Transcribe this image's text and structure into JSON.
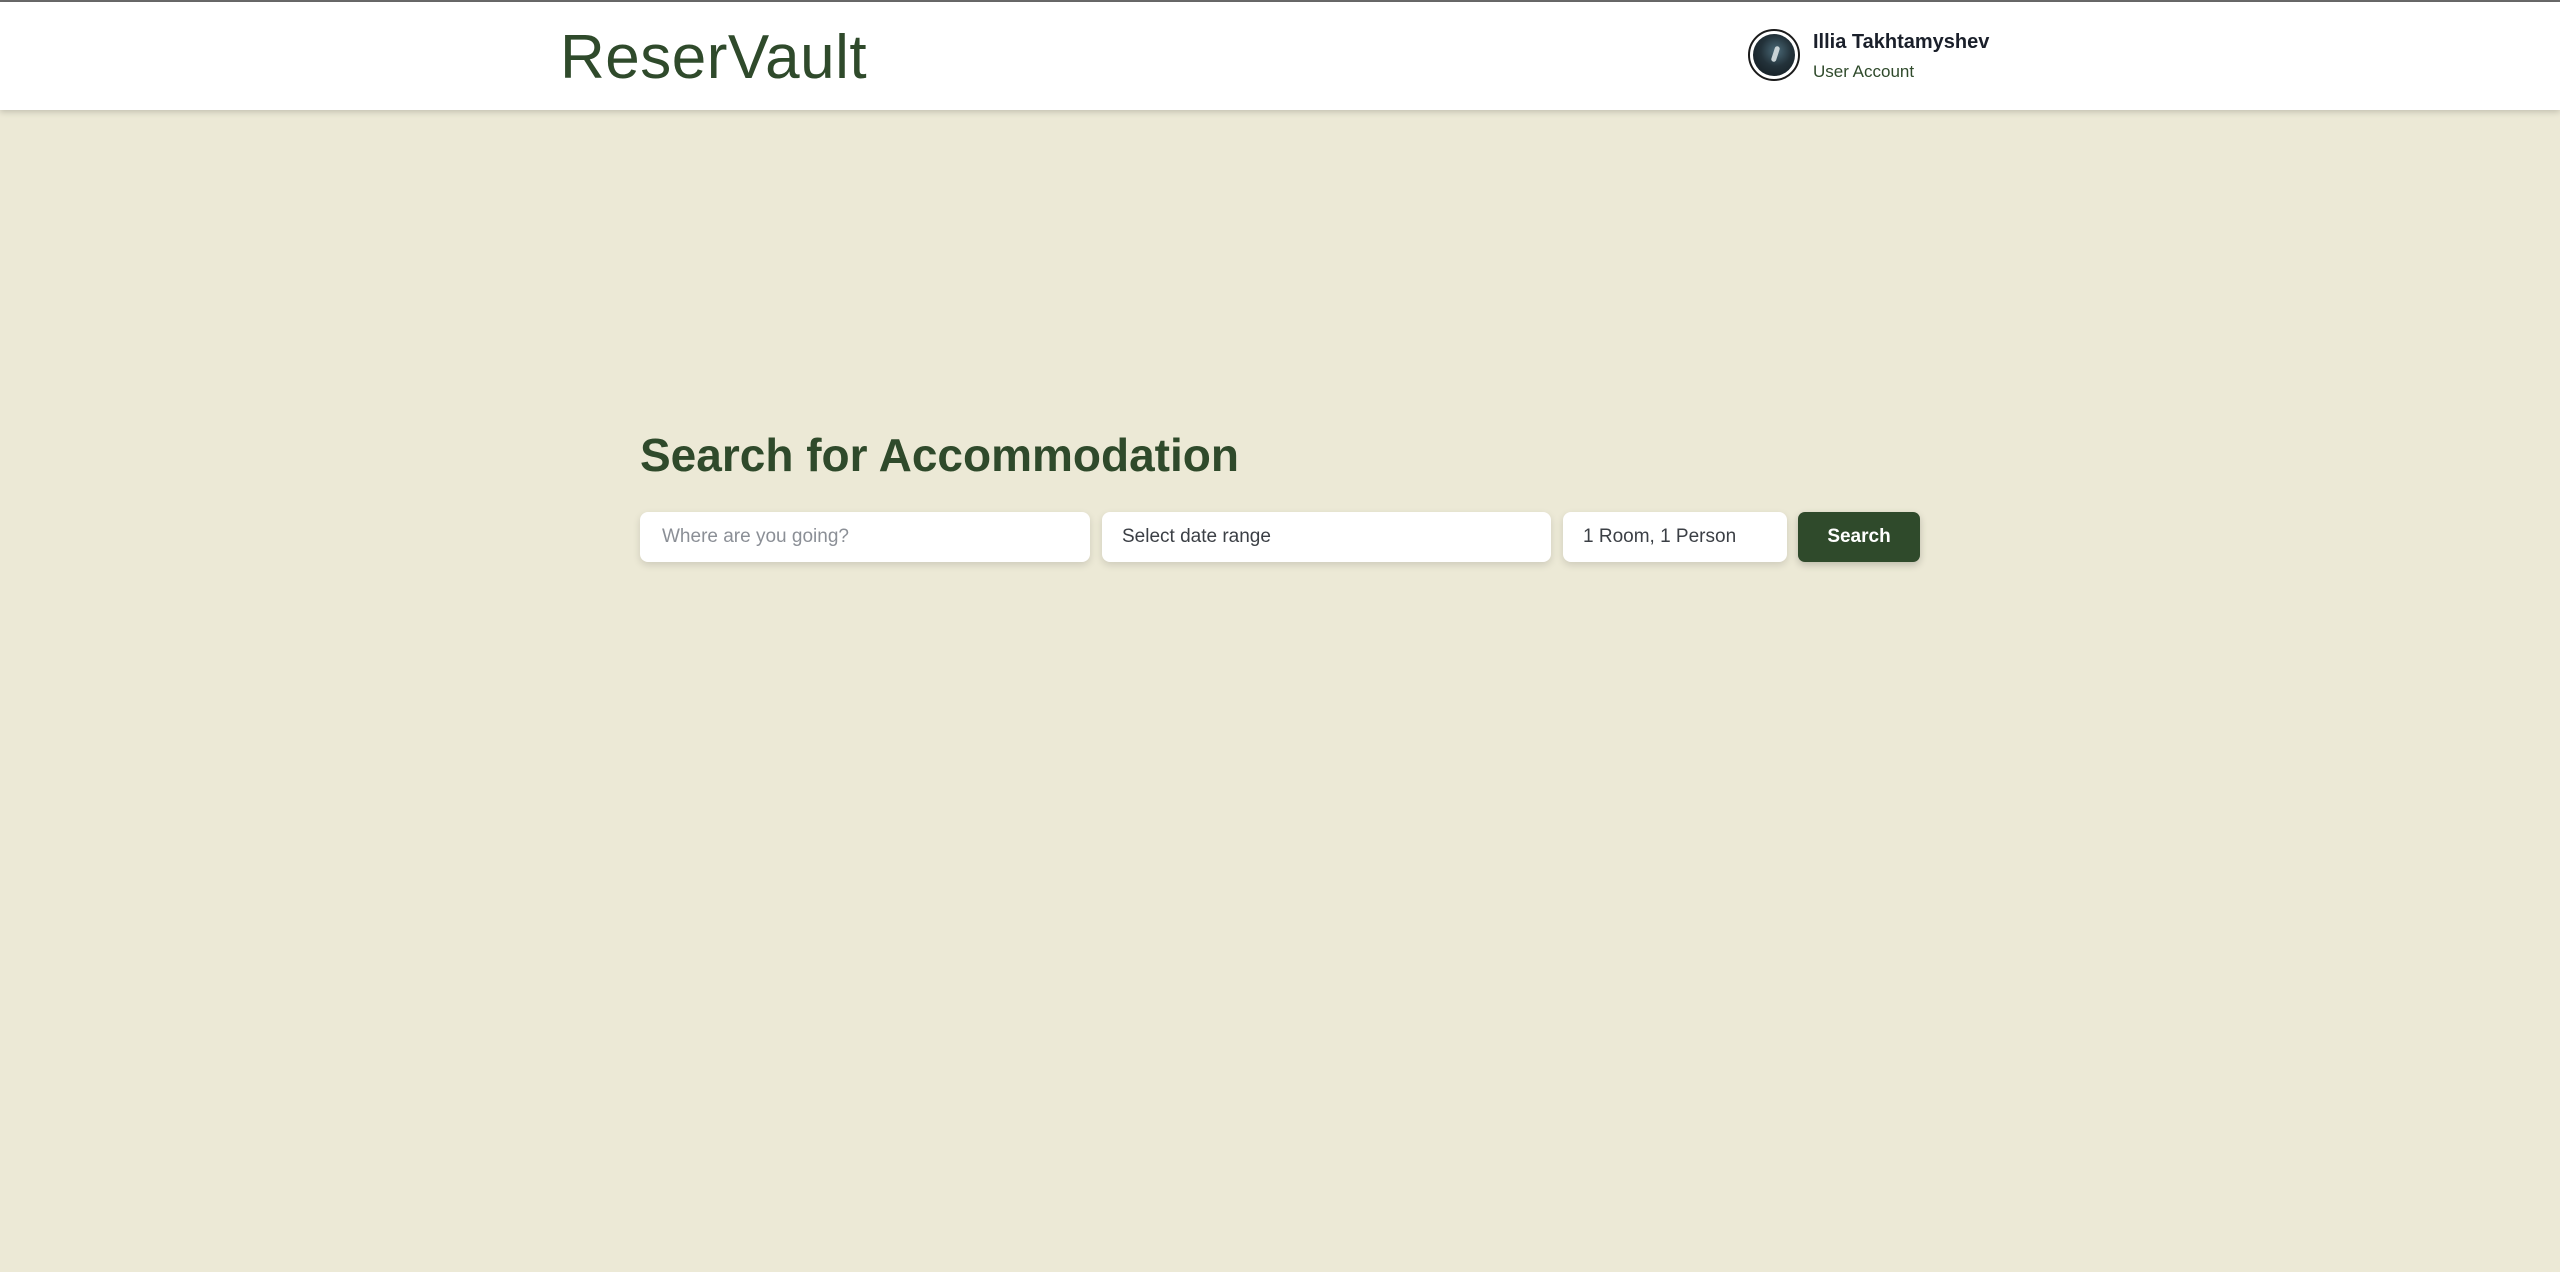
{
  "header": {
    "brand": "ReserVault",
    "user": {
      "name": "Illia Takhtamyshev",
      "role": "User Account"
    }
  },
  "search": {
    "title": "Search for Accommodation",
    "destination_placeholder": "Where are you going?",
    "destination_value": "",
    "date_range_label": "Select date range",
    "guests_label": "1 Room, 1 Person",
    "button_label": "Search"
  },
  "colors": {
    "background": "#ece9d6",
    "brand_green": "#2f4a2b",
    "header_bg": "#ffffff"
  }
}
